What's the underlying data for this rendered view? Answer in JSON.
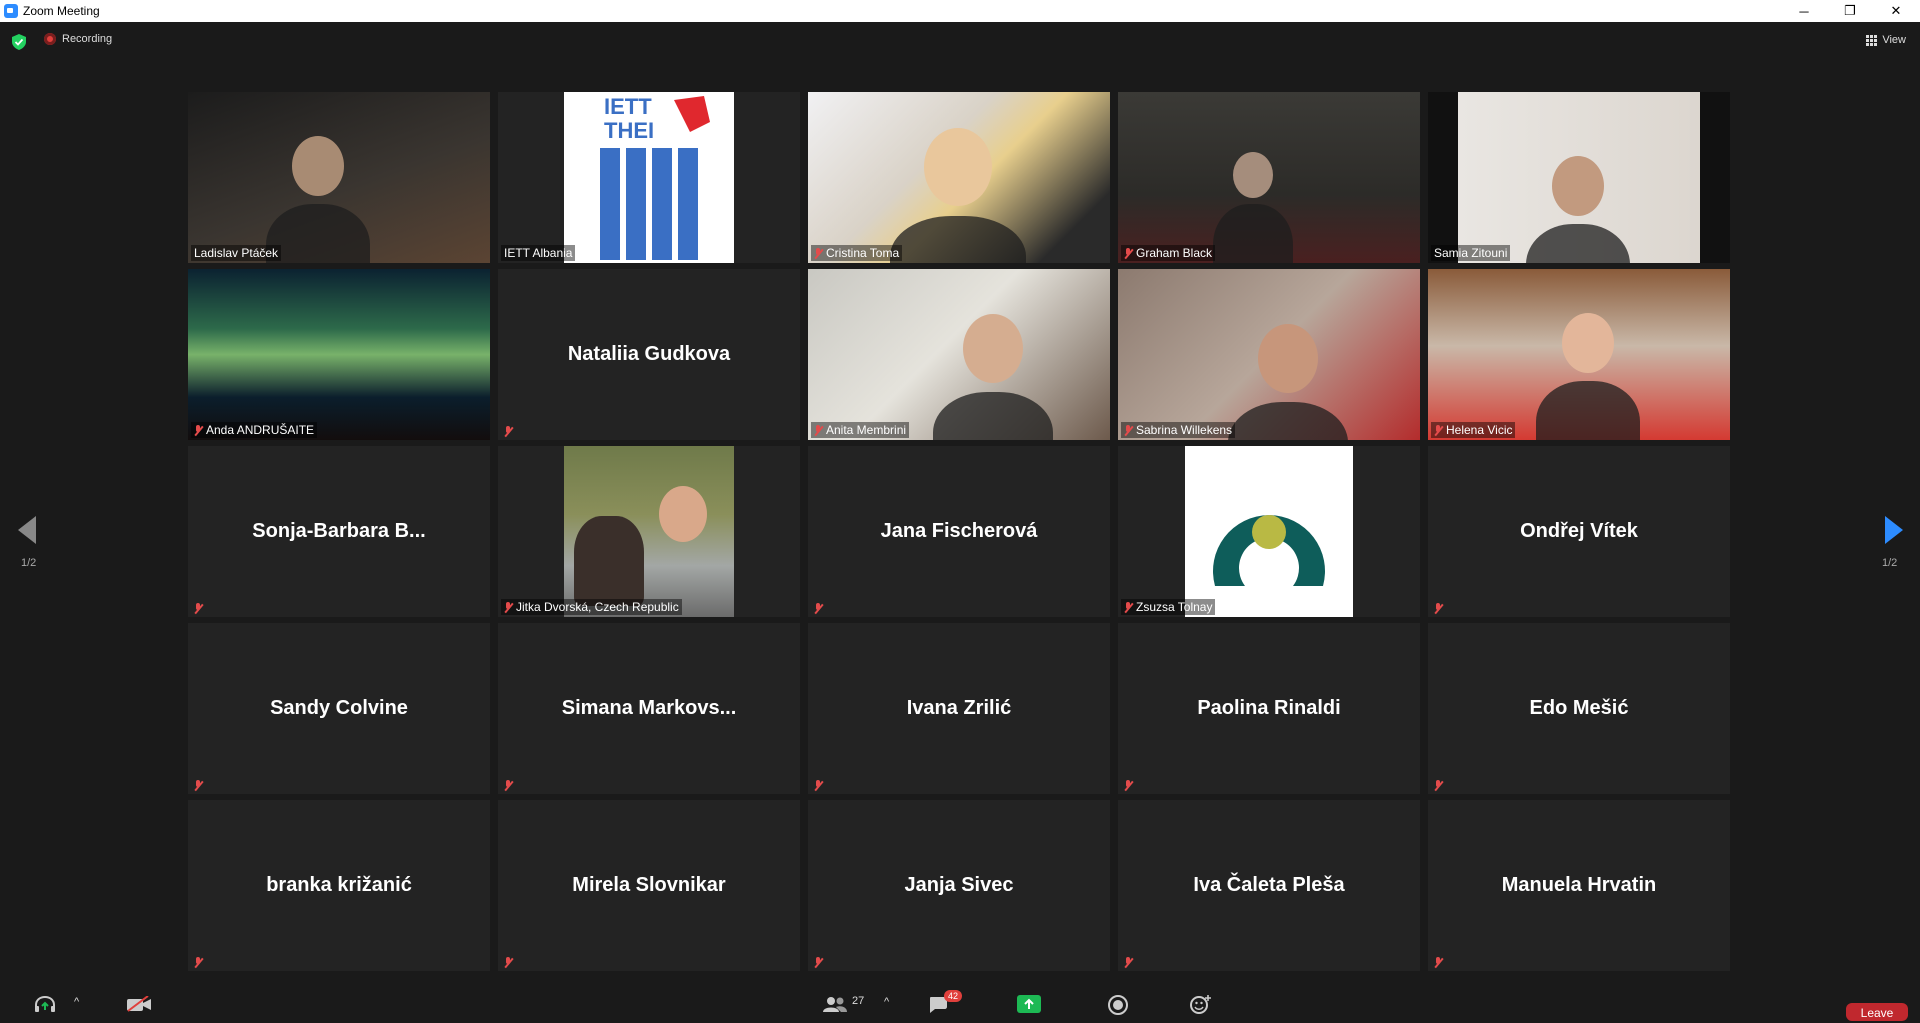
{
  "window": {
    "title": "Zoom Meeting",
    "minimize": "─",
    "restore": "❐",
    "close": "✕"
  },
  "topbar": {
    "recording_label": "Recording",
    "view_label": "View"
  },
  "pagination": {
    "left": "1/2",
    "right": "1/2"
  },
  "participants": [
    {
      "name": "Ladislav Ptáček",
      "video": true,
      "muted": false,
      "active": true
    },
    {
      "name": "IETT Albania",
      "video": true,
      "muted": false
    },
    {
      "name": "Cristina Toma",
      "video": true,
      "muted": true
    },
    {
      "name": "Graham Black",
      "video": true,
      "muted": true
    },
    {
      "name": "Samia Zitouni",
      "video": true,
      "muted": false
    },
    {
      "name": "Anda ANDRUŠAITE",
      "video": true,
      "muted": true
    },
    {
      "name": "Nataliia Gudkova",
      "video": false,
      "muted": true
    },
    {
      "name": "Anita Membrini",
      "video": true,
      "muted": true
    },
    {
      "name": "Sabrina Willekens",
      "video": true,
      "muted": true
    },
    {
      "name": "Helena Vicic",
      "video": true,
      "muted": true
    },
    {
      "name": "Sonja-Barbara  B...",
      "video": false,
      "muted": true
    },
    {
      "name": "Jitka Dvorská, Czech Republic",
      "video": true,
      "muted": true
    },
    {
      "name": "Jana Fischerová",
      "video": false,
      "muted": true
    },
    {
      "name": "Zsuzsa Tolnay",
      "video": true,
      "muted": true
    },
    {
      "name": "Ondřej Vítek",
      "video": false,
      "muted": true
    },
    {
      "name": "Sandy Colvine",
      "video": false,
      "muted": true
    },
    {
      "name": "Simana  Markovs...",
      "video": false,
      "muted": true
    },
    {
      "name": "Ivana Zrilić",
      "video": false,
      "muted": true
    },
    {
      "name": "Paolina Rinaldi",
      "video": false,
      "muted": true
    },
    {
      "name": "Edo Mešić",
      "video": false,
      "muted": true
    },
    {
      "name": "branka križanić",
      "video": false,
      "muted": true
    },
    {
      "name": "Mirela Slovnikar",
      "video": false,
      "muted": true
    },
    {
      "name": "Janja Sivec",
      "video": false,
      "muted": true
    },
    {
      "name": "Iva Čaleta Pleša",
      "video": false,
      "muted": true
    },
    {
      "name": "Manuela Hrvatin",
      "video": false,
      "muted": true
    }
  ],
  "toolbar": {
    "participants_count": "27",
    "chat_badge": "42",
    "leave_label": "Leave",
    "caret": "^"
  },
  "colors": {
    "active_border": "#d8e86a",
    "leave": "#c0282e",
    "share": "#1db954",
    "nav_arrow_right": "#2d8cff"
  }
}
